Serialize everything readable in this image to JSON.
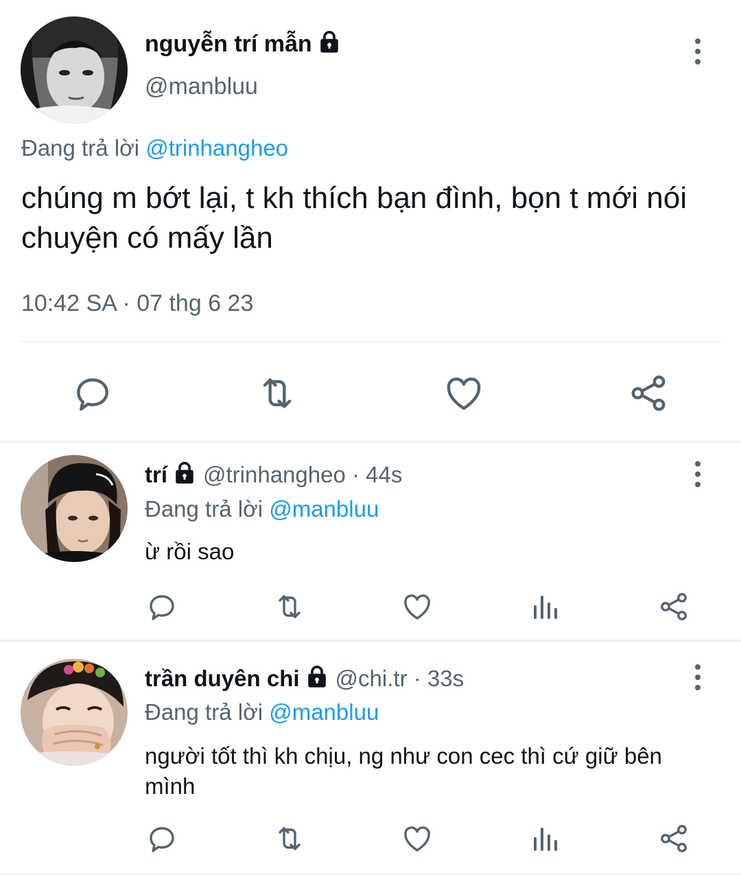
{
  "main_tweet": {
    "display_name": "nguyễn trí mẫn",
    "handle": "@manbluu",
    "reply_prefix": "Đang trả lời",
    "reply_to": "@trinhangheo",
    "text": "chúng m bớt lại, t kh thích bạn đình, bọn t mới nói chuyện có mấy lần",
    "timestamp": "10:42 SA · 07 thg 6 23",
    "actions": [
      "reply-icon",
      "retweet-icon",
      "like-icon",
      "share-icon"
    ]
  },
  "replies": [
    {
      "display_name": "trí",
      "handle": "@trinhangheo",
      "time": "· 44s",
      "reply_prefix": "Đang trả lời",
      "reply_to": "@manbluu",
      "text": "ừ rồi sao",
      "actions": [
        "reply-icon",
        "retweet-icon",
        "like-icon",
        "views-icon",
        "share-icon"
      ]
    },
    {
      "display_name": "trần duyên chi",
      "handle": "@chi.tr",
      "time": "· 33s",
      "reply_prefix": "Đang trả lời",
      "reply_to": "@manbluu",
      "text": "người tốt thì kh chịu, ng như con cec thì cứ giữ bên mình",
      "actions": [
        "reply-icon",
        "retweet-icon",
        "like-icon",
        "views-icon",
        "share-icon"
      ]
    }
  ],
  "colors": {
    "text": "#0f1419",
    "secondary": "#536471",
    "link": "#1d9bf0",
    "divider": "#eff3f4"
  }
}
